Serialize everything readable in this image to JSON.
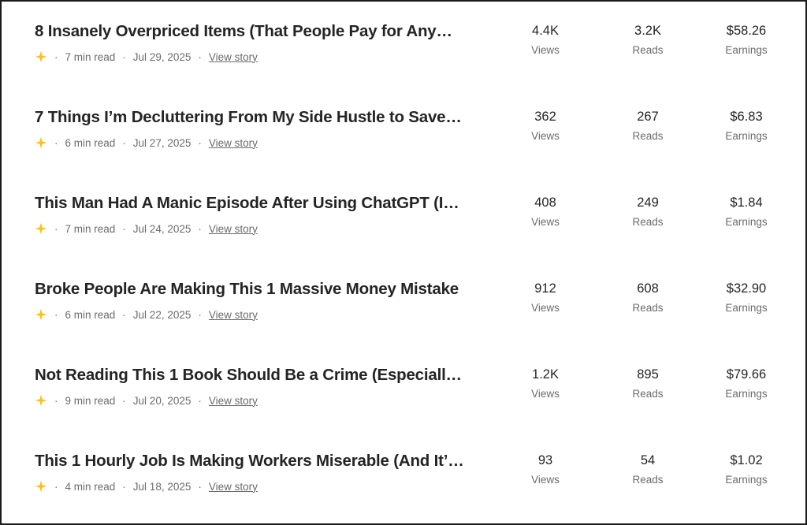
{
  "colors": {
    "star": "#FFC017",
    "text": "#242424",
    "muted": "#6b6b6b"
  },
  "labels": {
    "views": "Views",
    "reads": "Reads",
    "earnings": "Earnings",
    "view_story": "View story",
    "separator": "·"
  },
  "stories": [
    {
      "title": "8 Insanely Overpriced Items (That People Pay for Any…",
      "read_time": "7 min read",
      "date": "Jul 29, 2025",
      "views": "4.4K",
      "reads": "3.2K",
      "earnings": "$58.26"
    },
    {
      "title": "7 Things I’m Decluttering From My Side Hustle to Save…",
      "read_time": "6 min read",
      "date": "Jul 27, 2025",
      "views": "362",
      "reads": "267",
      "earnings": "$6.83"
    },
    {
      "title": "This Man Had A Manic Episode After Using ChatGPT (I…",
      "read_time": "7 min read",
      "date": "Jul 24, 2025",
      "views": "408",
      "reads": "249",
      "earnings": "$1.84"
    },
    {
      "title": "Broke People Are Making This 1 Massive Money Mistake",
      "read_time": "6 min read",
      "date": "Jul 22, 2025",
      "views": "912",
      "reads": "608",
      "earnings": "$32.90"
    },
    {
      "title": "Not Reading This 1 Book Should Be a Crime (Especiall…",
      "read_time": "9 min read",
      "date": "Jul 20, 2025",
      "views": "1.2K",
      "reads": "895",
      "earnings": "$79.66"
    },
    {
      "title": "This 1 Hourly Job Is Making Workers Miserable (And It’…",
      "read_time": "4 min read",
      "date": "Jul 18, 2025",
      "views": "93",
      "reads": "54",
      "earnings": "$1.02"
    }
  ]
}
